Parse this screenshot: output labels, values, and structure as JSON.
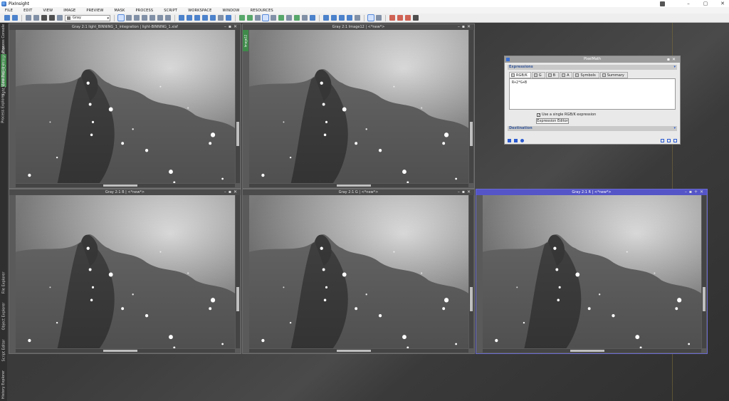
{
  "app": {
    "title": "PixInsight"
  },
  "menu": [
    "FILE",
    "EDIT",
    "VIEW",
    "IMAGE",
    "PREVIEW",
    "MASK",
    "PROCESS",
    "SCRIPT",
    "WORKSPACE",
    "WINDOW",
    "RESOURCES"
  ],
  "toolbar": {
    "channel_select": "Gray"
  },
  "sidetabs": {
    "process_console": "Process Console",
    "light_integration": "light_BINNING_1_integration",
    "view_explorer": "View Explorer",
    "process_explorer": "Process Explorer",
    "file_explorer": "File Explorer",
    "object_explorer": "Object Explorer",
    "script_editor": "Script Editor",
    "history_explorer": "History Explorer"
  },
  "windows": [
    {
      "title": "Gray 2:1 light_BINNING_1_integration | light-BINNING_1.xisf",
      "view_id": ""
    },
    {
      "title": "Gray 2:1 Image12 | <*new*>",
      "view_id": "Image12"
    },
    {
      "title": "Gray 2:1 B | <*new*>",
      "view_id": ""
    },
    {
      "title": "Gray 2:1 G | <*new*>",
      "view_id": ""
    },
    {
      "title": "Gray 2:1 R | <*new*>",
      "view_id": ""
    }
  ],
  "pixelmath": {
    "title": "PixelMath",
    "expressions_label": "Expressions",
    "tabs": [
      "RGB/K",
      "G",
      "B",
      "A",
      "Symbols",
      "Summary"
    ],
    "expression": "R+2*G+B",
    "single_expression_label": "Use a single RGB/K expression",
    "single_expression_checked": true,
    "expression_editor_label": "Expression Editor",
    "destination_label": "Destination"
  }
}
